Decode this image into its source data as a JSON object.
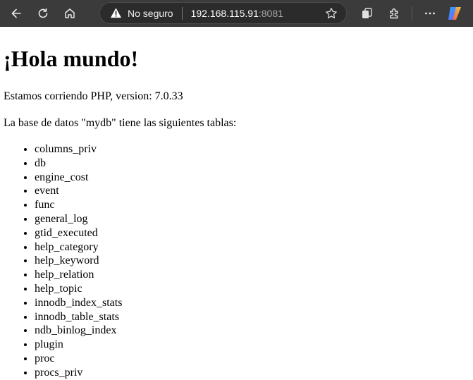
{
  "browser": {
    "security_text": "No seguro",
    "url_host": "192.168.115.91",
    "url_port": ":8081",
    "icons": [
      "back-icon",
      "reload-icon",
      "home-icon",
      "warning-icon",
      "star-icon",
      "collections-icon",
      "extensions-icon",
      "more-icon",
      "copilot-icon"
    ]
  },
  "page": {
    "heading": "¡Hola mundo!",
    "version_line": "Estamos corriendo PHP, version: 7.0.33",
    "tables_line": "La base de datos \"mydb\" tiene las siguientes tablas:",
    "tables": [
      "columns_priv",
      "db",
      "engine_cost",
      "event",
      "func",
      "general_log",
      "gtid_executed",
      "help_category",
      "help_keyword",
      "help_relation",
      "help_topic",
      "innodb_index_stats",
      "innodb_table_stats",
      "ndb_binlog_index",
      "plugin",
      "proc",
      "procs_priv"
    ]
  }
}
